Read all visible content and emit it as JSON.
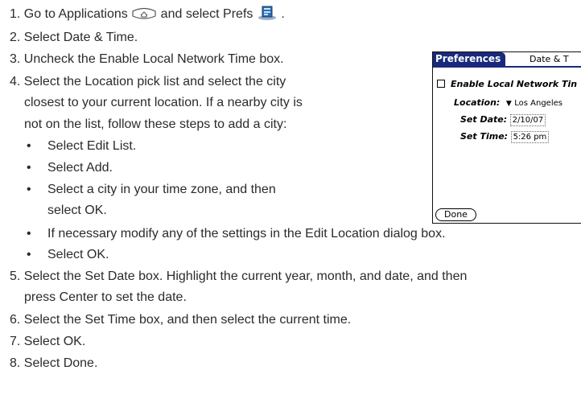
{
  "steps": {
    "s1_a": "1. Go to Applications",
    "s1_b": "and select Prefs",
    "s1_c": ".",
    "s2": "2. Select Date & Time.",
    "s3": "3. Uncheck the Enable Local Network Time box.",
    "s4_l1": "4. Select the Location pick list and select the city",
    "s4_l2": "closest to your current location. If a nearby city is",
    "s4_l3": "not on the list, follow these steps to add a city:",
    "b1": "Select Edit List.",
    "b2": "Select Add.",
    "b3_l1": "Select a city in your time zone, and then",
    "b3_l2": "select OK.",
    "b4": "If necessary modify any of the settings in the Edit Location dialog box.",
    "b5": "Select OK.",
    "s5_l1": "5. Select the Set Date box. Highlight the current year, month, and date, and then",
    "s5_l2": "press Center to set the date.",
    "s6": "6. Select the Set Time box, and then select the current time.",
    "s7": "7. Select OK.",
    "s8": "8. Select Done.",
    "bullet": "•"
  },
  "icons": {
    "applications": "applications-home-icon",
    "prefs": "prefs-icon"
  },
  "device": {
    "tab_title": "Preferences",
    "category": "Date & T",
    "enable_label": "Enable Local Network Tin",
    "location_label": "Location:",
    "location_arrow": "▼",
    "location_value": "Los Angeles",
    "date_label": "Set Date:",
    "date_value": "2/10/07",
    "time_label": "Set Time:",
    "time_value": "5:26 pm",
    "done_button": "Done",
    "accent_color": "#1a2a7a"
  }
}
